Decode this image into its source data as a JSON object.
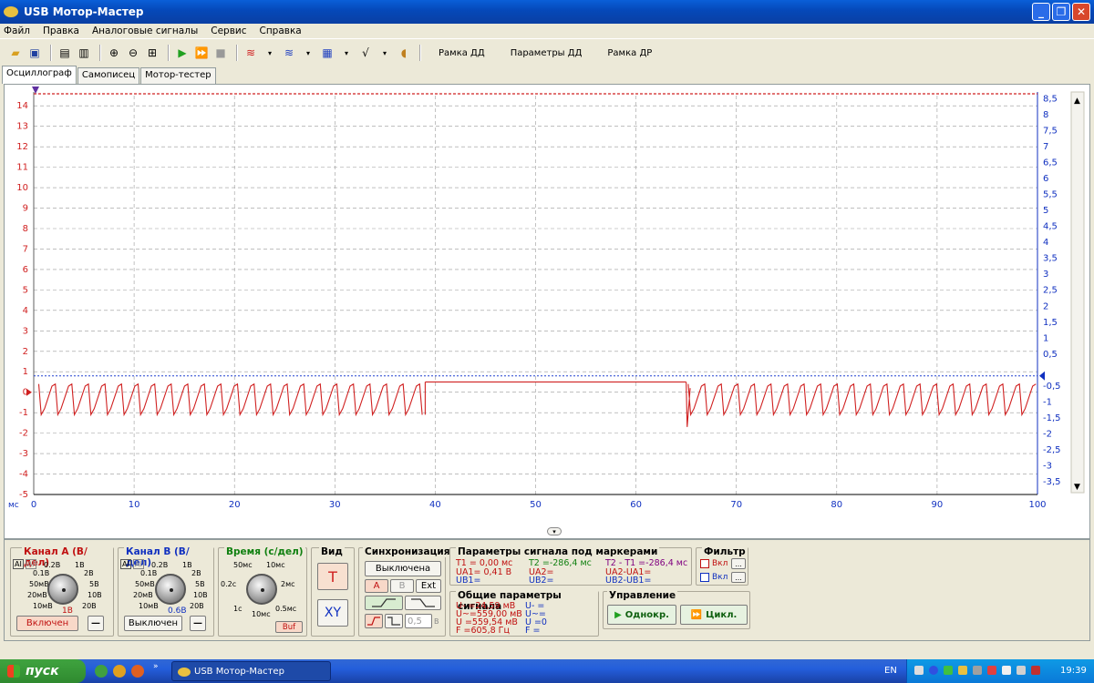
{
  "window": {
    "title": "USB Мотор-Мастер",
    "btn_min": "_",
    "btn_max": "❐",
    "btn_close": "✕"
  },
  "menu": [
    "Файл",
    "Правка",
    "Аналоговые сигналы",
    "Сервис",
    "Справка"
  ],
  "toolbar": {
    "t1": "Рамка ДД",
    "t2": "Параметры ДД",
    "t3": "Рамка ДР"
  },
  "tabs": [
    "Осциллограф",
    "Самописец",
    "Мотор-тестер"
  ],
  "chart_data": {
    "type": "line",
    "x_unit_label": "мс",
    "xlim": [
      0,
      100
    ],
    "x_ticks": [
      "0",
      "10",
      "20",
      "30",
      "40",
      "50",
      "60",
      "70",
      "80",
      "90",
      "100"
    ],
    "y_left_lim": [
      -5,
      14.5
    ],
    "y_left_ticks": [
      "14",
      "13",
      "12",
      "11",
      "10",
      "9",
      "8",
      "7",
      "6",
      "5",
      "4",
      "3",
      "2",
      "1",
      "0",
      "-1",
      "-2",
      "-3",
      "-4",
      "-5"
    ],
    "y_right_lim": [
      -3.9,
      8.6
    ],
    "y_right_ticks": [
      "8,5",
      "8",
      "7,5",
      "7",
      "6,5",
      "6",
      "5,5",
      "5",
      "4,5",
      "4",
      "3,5",
      "3",
      "2,5",
      "2",
      "1,5",
      "1",
      "0,5",
      "-0,5",
      "-1",
      "-1,5",
      "-2",
      "-2,5",
      "-3",
      "-3,5"
    ],
    "series": [
      {
        "color": "#d02020",
        "segments": [
          {
            "x_start": 0.5,
            "x_end": 39,
            "kind": "pulses",
            "period": 1.65,
            "low": -1.1,
            "high": 0.4
          },
          {
            "x_start": 39,
            "x_end": 65,
            "kind": "flat",
            "value": 0.5
          },
          {
            "x_start": 65.2,
            "x_end": 100,
            "kind": "pulses",
            "period": 1.65,
            "low": -1.1,
            "high": 0.4
          }
        ]
      }
    ],
    "channel_b_level": 0.8,
    "grid": true
  },
  "bottom": {
    "chA": {
      "title": "Канал А (В/дел)",
      "labels": [
        "0.1В",
        "0.2В",
        "1В",
        "2В",
        "5В",
        "10В",
        "20В",
        "50мВ",
        "20мВ",
        "10мВ"
      ],
      "current": "1В",
      "btn": "Включен",
      "minus": "—"
    },
    "chB": {
      "title": "Канал В (В/дел)",
      "labels": [
        "0.1В",
        "0.2В",
        "1В",
        "2В",
        "5В",
        "10В",
        "20В",
        "50мВ",
        "20мВ",
        "10мВ"
      ],
      "current": "0.6В",
      "btn": "Выключен",
      "minus": "—"
    },
    "time": {
      "title": "Время (с/дел)",
      "labels": [
        "50мс",
        "10мс",
        "0.2с",
        "2мс",
        "1с",
        "0.5мс",
        "10мс"
      ],
      "buf": "Buf"
    },
    "view": {
      "title": "Вид",
      "t": "T",
      "xy": "XY"
    },
    "sync": {
      "title": "Синхронизация",
      "state": "Выключена",
      "a": "A",
      "b": "B",
      "ext": "Ext",
      "level": "0,5",
      "unit": "В"
    },
    "markers": {
      "title": "Параметры сигнала под маркерами",
      "t1": "T1 = 0,00 мс",
      "t2": "T2 =-286,4 мс",
      "t21": "T2 - T1 =-286,4 мс",
      "ua1": "UA1= 0,41 В",
      "ua2": "UA2=",
      "ua21": "UA2-UA1=",
      "ub1": "UB1=",
      "ub2": "UB2=",
      "ub21": "UB2-UB1="
    },
    "general": {
      "title": "Общие параметры сигнала",
      "umin": "U- =24,59 мВ",
      "uac": "U~=559,00 мВ",
      "u": "U =559,54 мВ",
      "f": "F =605,8 Гц",
      "umin_b": "U- =",
      "uac_b": "U~=",
      "u_b": "U =0",
      "f_b": "F ="
    },
    "filter": {
      "title": "Фильтр",
      "on1": "Вкл",
      "on2": "Вкл",
      "dots": "..."
    },
    "control": {
      "title": "Управление",
      "single": "Однокр.",
      "cycle": "Цикл."
    }
  },
  "taskbar": {
    "start": "пуск",
    "item": "USB Мотор-Мастер",
    "lang": "EN",
    "time": "19:39"
  }
}
